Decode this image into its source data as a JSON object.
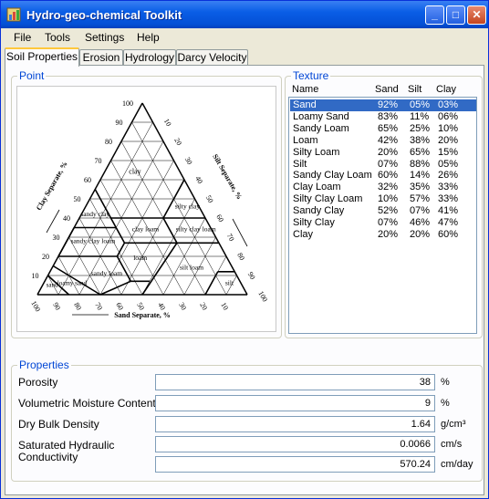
{
  "window": {
    "title": "Hydro-geo-chemical Toolkit",
    "icon": "app-icon",
    "min": "_",
    "max": "□",
    "close": "✕"
  },
  "menu": [
    "File",
    "Tools",
    "Settings",
    "Help"
  ],
  "tabs": [
    "Soil Properties",
    "Erosion",
    "Hydrology",
    "Darcy Velocity"
  ],
  "point_group": {
    "label": "Point",
    "diagram": {
      "clay_axis_label": "Clay Separate, %",
      "silt_axis_label": "Silt Separate, %",
      "sand_axis_label": "Sand Separate, %",
      "left_ticks": [
        "100",
        "90",
        "80",
        "70",
        "60",
        "50",
        "40",
        "30",
        "20",
        "10"
      ],
      "right_ticks": [
        "10",
        "20",
        "30",
        "40",
        "50",
        "60",
        "70",
        "80",
        "90",
        "100"
      ],
      "bottom_ticks": [
        "100",
        "90",
        "80",
        "70",
        "60",
        "50",
        "40",
        "30",
        "20",
        "10"
      ],
      "regions": [
        "clay",
        "silty clay",
        "sandy clay",
        "clay loam",
        "silty clay loam",
        "sandy clay loam",
        "loam",
        "silt loam",
        "sandy loam",
        "silt",
        "loamy sand",
        "sand"
      ]
    }
  },
  "texture_group": {
    "label": "Texture",
    "headers": {
      "name": "Name",
      "sand": "Sand",
      "silt": "Silt",
      "clay": "Clay"
    },
    "rows": [
      {
        "name": "Sand",
        "sand": "92%",
        "silt": "05%",
        "clay": "03%"
      },
      {
        "name": "Loamy Sand",
        "sand": "83%",
        "silt": "11%",
        "clay": "06%"
      },
      {
        "name": "Sandy Loam",
        "sand": "65%",
        "silt": "25%",
        "clay": "10%"
      },
      {
        "name": "Loam",
        "sand": "42%",
        "silt": "38%",
        "clay": "20%"
      },
      {
        "name": "Silty Loam",
        "sand": "20%",
        "silt": "65%",
        "clay": "15%"
      },
      {
        "name": "Silt",
        "sand": "07%",
        "silt": "88%",
        "clay": "05%"
      },
      {
        "name": "Sandy Clay Loam",
        "sand": "60%",
        "silt": "14%",
        "clay": "26%"
      },
      {
        "name": "Clay Loam",
        "sand": "32%",
        "silt": "35%",
        "clay": "33%"
      },
      {
        "name": "Silty Clay Loam",
        "sand": "10%",
        "silt": "57%",
        "clay": "33%"
      },
      {
        "name": "Sandy Clay",
        "sand": "52%",
        "silt": "07%",
        "clay": "41%"
      },
      {
        "name": "Silty Clay",
        "sand": "07%",
        "silt": "46%",
        "clay": "47%"
      },
      {
        "name": "Clay",
        "sand": "20%",
        "silt": "20%",
        "clay": "60%"
      }
    ],
    "selected": "Sand"
  },
  "properties_group": {
    "label": "Properties",
    "porosity": {
      "label": "Porosity",
      "value": "38",
      "unit": "%"
    },
    "moisture": {
      "label": "Volumetric Moisture Content",
      "value": "9",
      "unit": "%"
    },
    "bulk_density": {
      "label": "Dry Bulk Density",
      "value": "1.64",
      "unit": "g/cm³"
    },
    "conductivity": {
      "label_line1": "Saturated Hydraulic",
      "label_line2": "Conductivity",
      "value_cms": "0.0066",
      "unit_cms": "cm/s",
      "value_cmday": "570.24",
      "unit_cmday": "cm/day"
    }
  }
}
